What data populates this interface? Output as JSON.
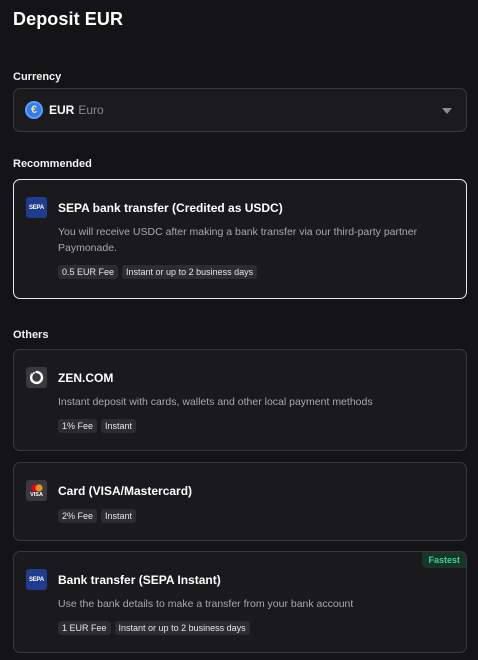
{
  "page": {
    "title": "Deposit EUR"
  },
  "currency": {
    "label": "Currency",
    "selected_code": "EUR",
    "selected_name": "Euro",
    "icon": "euro-coin-icon",
    "icon_glyph": "€"
  },
  "recommended": {
    "label": "Recommended",
    "method": {
      "title": "SEPA bank transfer (Credited as USDC)",
      "description": "You will receive USDC after making a bank transfer via our third-party partner Paymonade.",
      "logo": "sepa-logo",
      "logo_text": "SEPA",
      "tags": [
        "0.5 EUR Fee",
        "Instant or up to 2 business days"
      ]
    }
  },
  "others": {
    "label": "Others",
    "methods": [
      {
        "title": "ZEN.COM",
        "description": "Instant deposit with cards, wallets and other local payment methods",
        "logo": "zen-logo",
        "tags": [
          "1% Fee",
          "Instant"
        ]
      },
      {
        "title": "Card (VISA/Mastercard)",
        "description": "",
        "logo": "visa-mastercard-logo",
        "logo_text": "VISA",
        "tags": [
          "2% Fee",
          "Instant"
        ]
      },
      {
        "title": "Bank transfer (SEPA Instant)",
        "description": "Use the bank details to make a transfer from your bank account",
        "logo": "sepa-logo",
        "logo_text": "SEPA",
        "badge": "Fastest",
        "tags": [
          "1 EUR Fee",
          "Instant or up to 2 business days"
        ]
      }
    ]
  },
  "colors": {
    "background": "#141416",
    "card": "#1a1a1d",
    "accent_green": "#3fd28e",
    "sepa_blue": "#1f3c8f",
    "euro_blue": "#2f7bf5"
  }
}
